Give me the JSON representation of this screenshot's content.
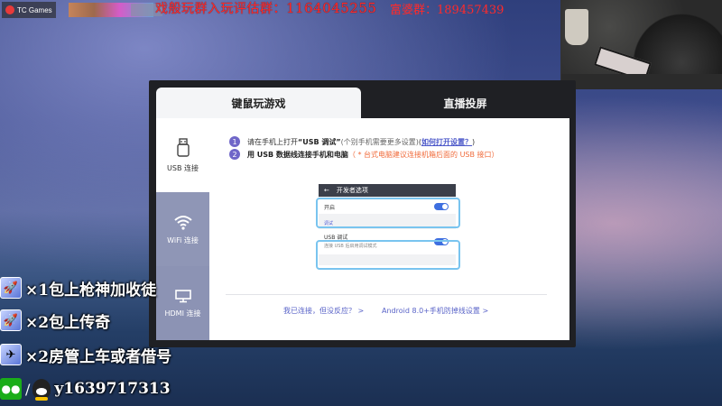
{
  "taskbar": {
    "app_label": "TC Games",
    "ticker_text": "戏般玩群入玩评估群：",
    "ticker_number": "1164045255",
    "ticker2_text": "富婆群：189457439"
  },
  "dialog": {
    "tabs": [
      {
        "label": "键鼠玩游戏",
        "active": true
      },
      {
        "label": "直播投屏",
        "active": false
      }
    ],
    "sidebar": [
      {
        "label": "USB 连接",
        "icon": "usb-icon",
        "active": true
      },
      {
        "label": "WiFi 连接",
        "icon": "wifi-icon",
        "active": false
      },
      {
        "label": "HDMI 连接",
        "icon": "hdmi-icon",
        "active": false
      }
    ],
    "steps": [
      {
        "num": "1",
        "pre": "请在手机上打开",
        "bold": "“USB 调试”",
        "muted": "(个别手机需要更多设置)",
        "paren_open": "(",
        "link": "如何打开设置？",
        "paren_close": ")"
      },
      {
        "num": "2",
        "bold": "用 USB 数据线连接手机和电脑",
        "warn": "（ * 台式电脑建议连接机箱后面的 USB 接口）"
      }
    ],
    "mock": {
      "header": "开发者选项",
      "back": "←",
      "row1": "开启",
      "section": "调试",
      "row2_title": "USB 调试",
      "row2_sub": "连接 USB 后启用调试模式"
    },
    "footer": {
      "link1": "我已连接，但没反应？ >",
      "link2": "Android 8.0+手机防掉线设置 >"
    }
  },
  "overlay": {
    "lines": [
      "×1包上枪神加收徒",
      "×2包上传奇",
      "×2房管上车或者借号"
    ],
    "contact": "y1639717313",
    "slash": "/"
  },
  "colors": {
    "accent": "#6f66c8",
    "link": "#4b57c9",
    "warn": "#f06b3b",
    "ticker": "#ff2a2a"
  }
}
